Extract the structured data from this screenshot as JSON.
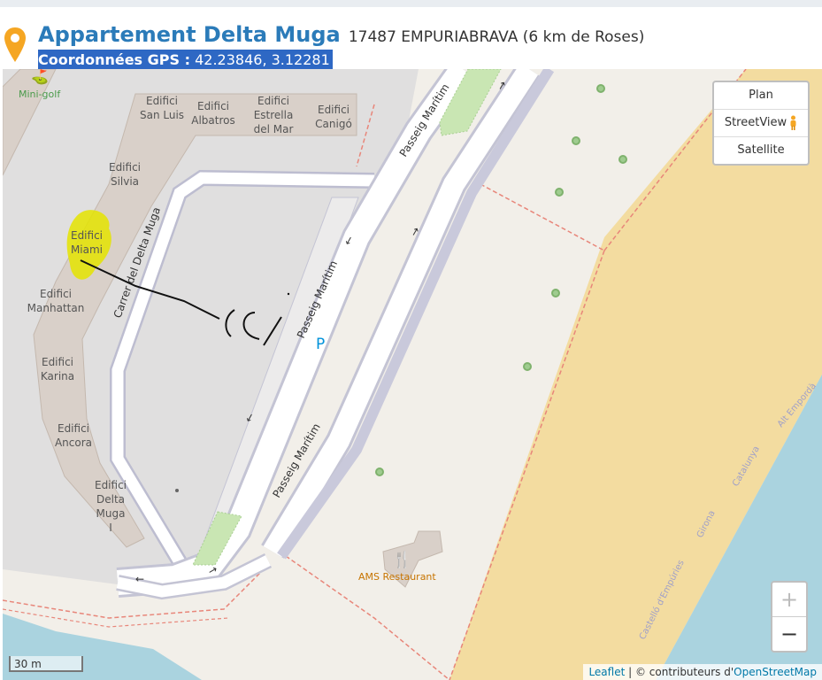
{
  "header": {
    "title": "Appartement Delta Muga",
    "address": "17487 EMPURIABRAVA (6 km de Roses)",
    "gps_label": "Coordonnées GPS :",
    "gps_value": "42.23846, 3.12281"
  },
  "map": {
    "layers": [
      "Plan",
      "StreetView",
      "Satellite"
    ],
    "zoom_in": "+",
    "zoom_out": "−",
    "scale": "30 m",
    "attribution": {
      "leaflet": "Leaflet",
      "separator": "| © contributeurs d'",
      "osm": "OpenStreetMap"
    },
    "labels": {
      "minigolf": "Mini-golf",
      "restaurant": "AMS Restaurant",
      "parking": "P",
      "carrer": "Carrer del Delta Muga",
      "passeig": "Passeig Marítim",
      "coast_1": "Castelló d'Empúries",
      "coast_2": "Girona",
      "coast_3": "Catalunya",
      "coast_4": "Alt Empordà"
    },
    "buildings": [
      [
        "Edifici",
        "San Luis"
      ],
      [
        "Edifici",
        "Albatros"
      ],
      [
        "Edifici",
        "Estrella",
        "del Mar"
      ],
      [
        "Edifici",
        "Canigó"
      ],
      [
        "Edifici",
        "Silvia"
      ],
      [
        "Edifici",
        "Miami"
      ],
      [
        "Edifici",
        "Manhattan"
      ],
      [
        "Edifici",
        "Karina"
      ],
      [
        "Edifici",
        "Ancora"
      ],
      [
        "Edifici",
        "Delta",
        "Muga",
        "I"
      ]
    ],
    "colors": {
      "title": "#2b7bb9",
      "highlight": "#2e68c4",
      "pin": "#f5a623",
      "beach": "#f3dca0",
      "sea": "#aad3df",
      "highlighter": "#e4e400"
    }
  }
}
